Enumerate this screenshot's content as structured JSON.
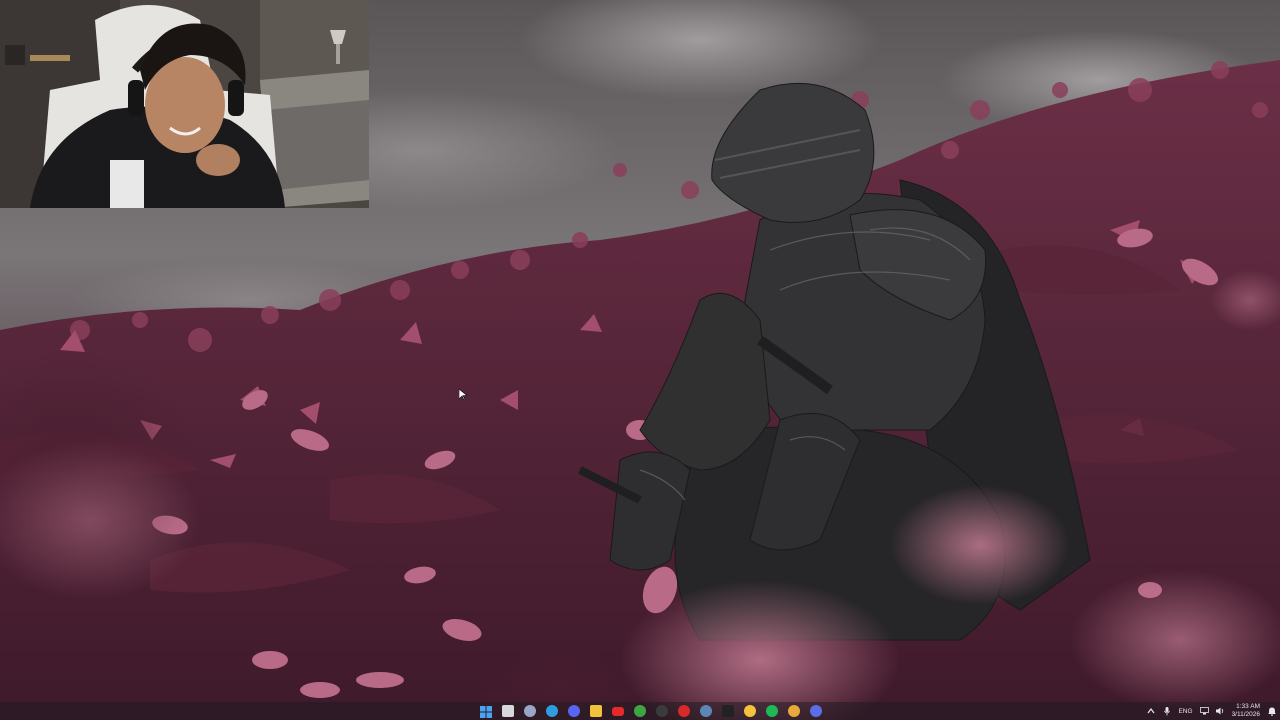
{
  "taskbar": {
    "apps": [
      {
        "icon": "windows-start-icon",
        "color": "#4aa3f0"
      },
      {
        "icon": "search-icon",
        "color": "#d8d8dc"
      },
      {
        "icon": "task-view-icon",
        "color": "#9aa6c8"
      },
      {
        "icon": "edge-browser-icon",
        "color": "#2f9be0"
      },
      {
        "icon": "discord-icon",
        "color": "#5865f2"
      },
      {
        "icon": "file-explorer-icon",
        "color": "#f2c23a"
      },
      {
        "icon": "youtube-icon",
        "color": "#e52a2a"
      },
      {
        "icon": "xbox-icon",
        "color": "#3ea63e"
      },
      {
        "icon": "obs-icon",
        "color": "#3b3b3b"
      },
      {
        "icon": "red-app-icon",
        "color": "#d92a2a"
      },
      {
        "icon": "steam-icon",
        "color": "#5d86b8"
      },
      {
        "icon": "capcut-icon",
        "color": "#222222"
      },
      {
        "icon": "yellow-app-icon",
        "color": "#f3c33b"
      },
      {
        "icon": "spotify-icon",
        "color": "#1db954"
      },
      {
        "icon": "chrome-icon",
        "color": "#e8a93a"
      },
      {
        "icon": "blue-app-icon",
        "color": "#5b6ee6"
      }
    ],
    "tray": {
      "language": "ENG",
      "time": "1:33 AM",
      "date": "3/11/2026"
    }
  },
  "colors": {
    "petal": "#b4657f",
    "petal_dark": "#6a2b42",
    "sky": "#6e6a6e",
    "armor": "#2b2a2c"
  }
}
